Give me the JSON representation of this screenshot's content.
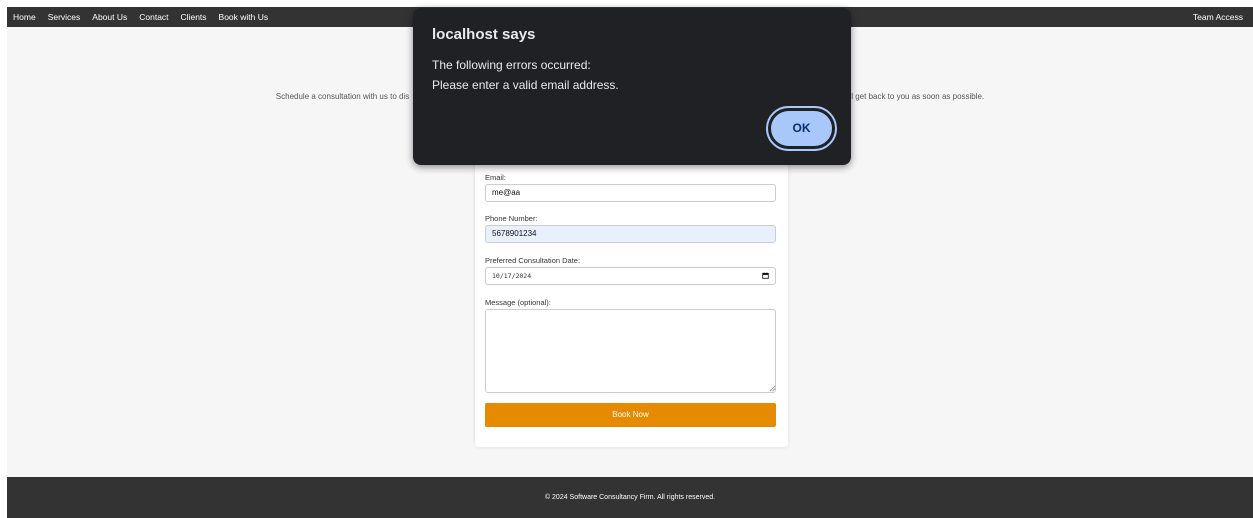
{
  "nav": {
    "links": [
      "Home",
      "Services",
      "About Us",
      "Contact",
      "Clients",
      "Book with Us"
    ],
    "team_access": "Team Access"
  },
  "intro": {
    "text_left": "Schedule a consultation with us to dis",
    "text_right": "l get back to you as soon as possible."
  },
  "form": {
    "email_label": "Email:",
    "email_value": "me@aa",
    "phone_label": "Phone Number:",
    "phone_value": "5678901234",
    "date_label": "Preferred Consultation Date:",
    "date_value": "10/17/2024",
    "message_label": "Message (optional):",
    "message_value": "",
    "submit_label": "Book Now"
  },
  "footer": {
    "text": "© 2024 Software Consultancy Firm. All rights reserved."
  },
  "dialog": {
    "title": "localhost says",
    "line1": "The following errors occurred:",
    "line2": "Please enter a valid email address.",
    "ok_label": "OK"
  },
  "colors": {
    "nav_bg": "#333333",
    "button_orange": "#e68a00",
    "dialog_bg": "#202124",
    "ok_button": "#a8c7fa",
    "autofill_bg": "#e8f0fe"
  },
  "icons": {
    "date_picker": "calendar-icon",
    "textarea_resize": "resize-handle-icon"
  }
}
